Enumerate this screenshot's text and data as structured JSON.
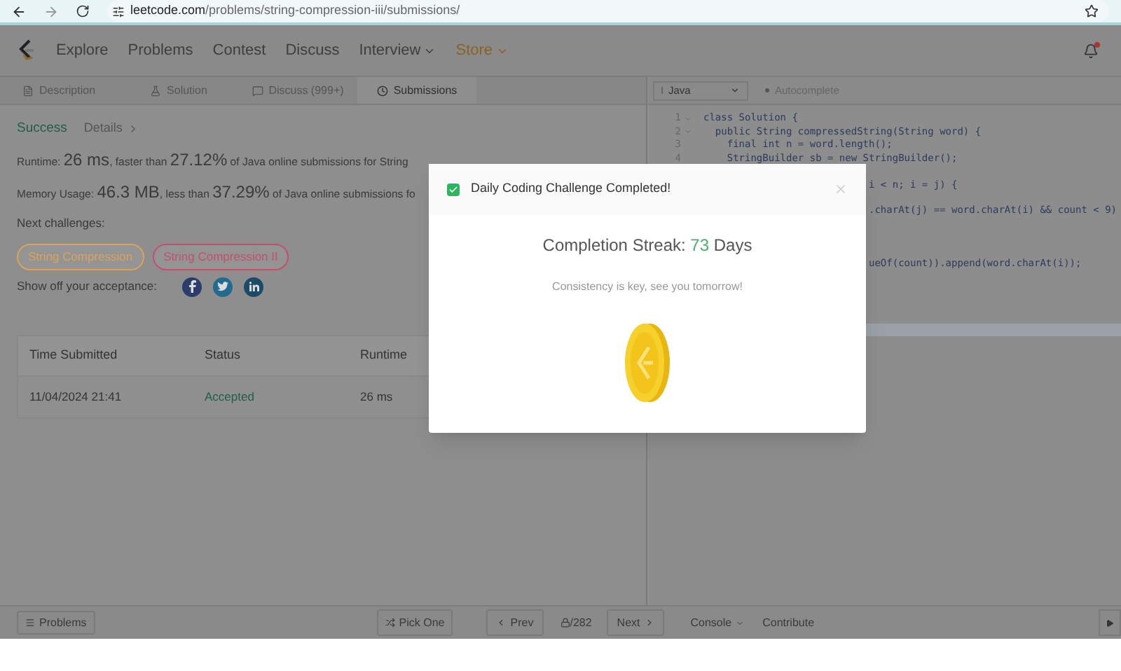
{
  "browser": {
    "url_host": "leetcode.com",
    "url_path": "/problems/string-compression-iii/submissions/"
  },
  "nav": {
    "items": [
      {
        "label": "Explore",
        "kind": "link"
      },
      {
        "label": "Problems",
        "kind": "link"
      },
      {
        "label": "Contest",
        "kind": "link"
      },
      {
        "label": "Discuss",
        "kind": "link"
      },
      {
        "label": "Interview",
        "kind": "menu"
      },
      {
        "label": "Store",
        "kind": "store"
      }
    ]
  },
  "tabs": [
    {
      "label": "Description",
      "selected": false
    },
    {
      "label": "Solution",
      "selected": false
    },
    {
      "label": "Discuss (999+)",
      "selected": false
    },
    {
      "label": "Submissions",
      "selected": true
    }
  ],
  "editor_toolbar": {
    "language": "Java",
    "autocomplete": "Autocomplete"
  },
  "result": {
    "status": "Success",
    "details": "Details",
    "runtime": {
      "label": "Runtime:",
      "value": "26 ms",
      "mid": ", faster than",
      "percent": "27.12%",
      "tail": "of Java online submissions for String"
    },
    "memory": {
      "label": "Memory Usage:",
      "value": "46.3 MB",
      "mid": ", less than",
      "percent": "37.29%",
      "tail": "of Java online submissions fo"
    },
    "next_label": "Next challenges:",
    "challenges": [
      {
        "label": "String Compression",
        "color": "#d9a45a"
      },
      {
        "label": "String Compression II",
        "color": "#c2506e"
      }
    ],
    "share_label": "Show off your acceptance:"
  },
  "table": {
    "columns": [
      "Time Submitted",
      "Status",
      "Runtime"
    ],
    "rows": [
      [
        "11/04/2024 21:41",
        "Accepted",
        "26 ms"
      ]
    ]
  },
  "code": {
    "lines": [
      {
        "number": "1",
        "fold": true,
        "text": "class Solution {"
      },
      {
        "number": "2",
        "fold": true,
        "text": "  public String compressedString(String word) {"
      },
      {
        "number": "3",
        "fold": false,
        "text": "    final int n = word.length();"
      },
      {
        "number": "4",
        "fold": false,
        "text": "    StringBuilder sb = new StringBuilder();"
      }
    ],
    "fragments": [
      "i < n; i = j) {",
      ".charAt(j) == word.charAt(i) && count < 9)",
      "ueOf(count)).append(word.charAt(i));"
    ]
  },
  "modal": {
    "title": "Daily Coding Challenge Completed!",
    "checked": true,
    "streak_label": "Completion Streak:",
    "streak_value": "73",
    "streak_unit": "Days",
    "message": "Consistency is key, see you tomorrow!"
  },
  "bottom": {
    "problems": "Problems",
    "pick": "Pick One",
    "prev": "Prev",
    "count": "/282",
    "next": "Next",
    "console": "Console",
    "contribute": "Contribute"
  }
}
